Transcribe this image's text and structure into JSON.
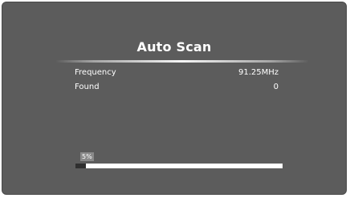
{
  "dialog": {
    "title": "Auto Scan"
  },
  "info": {
    "frequency_label": "Frequency",
    "frequency_value": "91.25MHz",
    "found_label": "Found",
    "found_value": "0"
  },
  "progress": {
    "percent_text": "5%",
    "percent": 5
  },
  "colors": {
    "background": "#5c5c5c",
    "text": "#ffffff",
    "progress_track": "#ffffff",
    "progress_fill": "#2f2f2f",
    "percent_badge": "#8a8a8a"
  }
}
